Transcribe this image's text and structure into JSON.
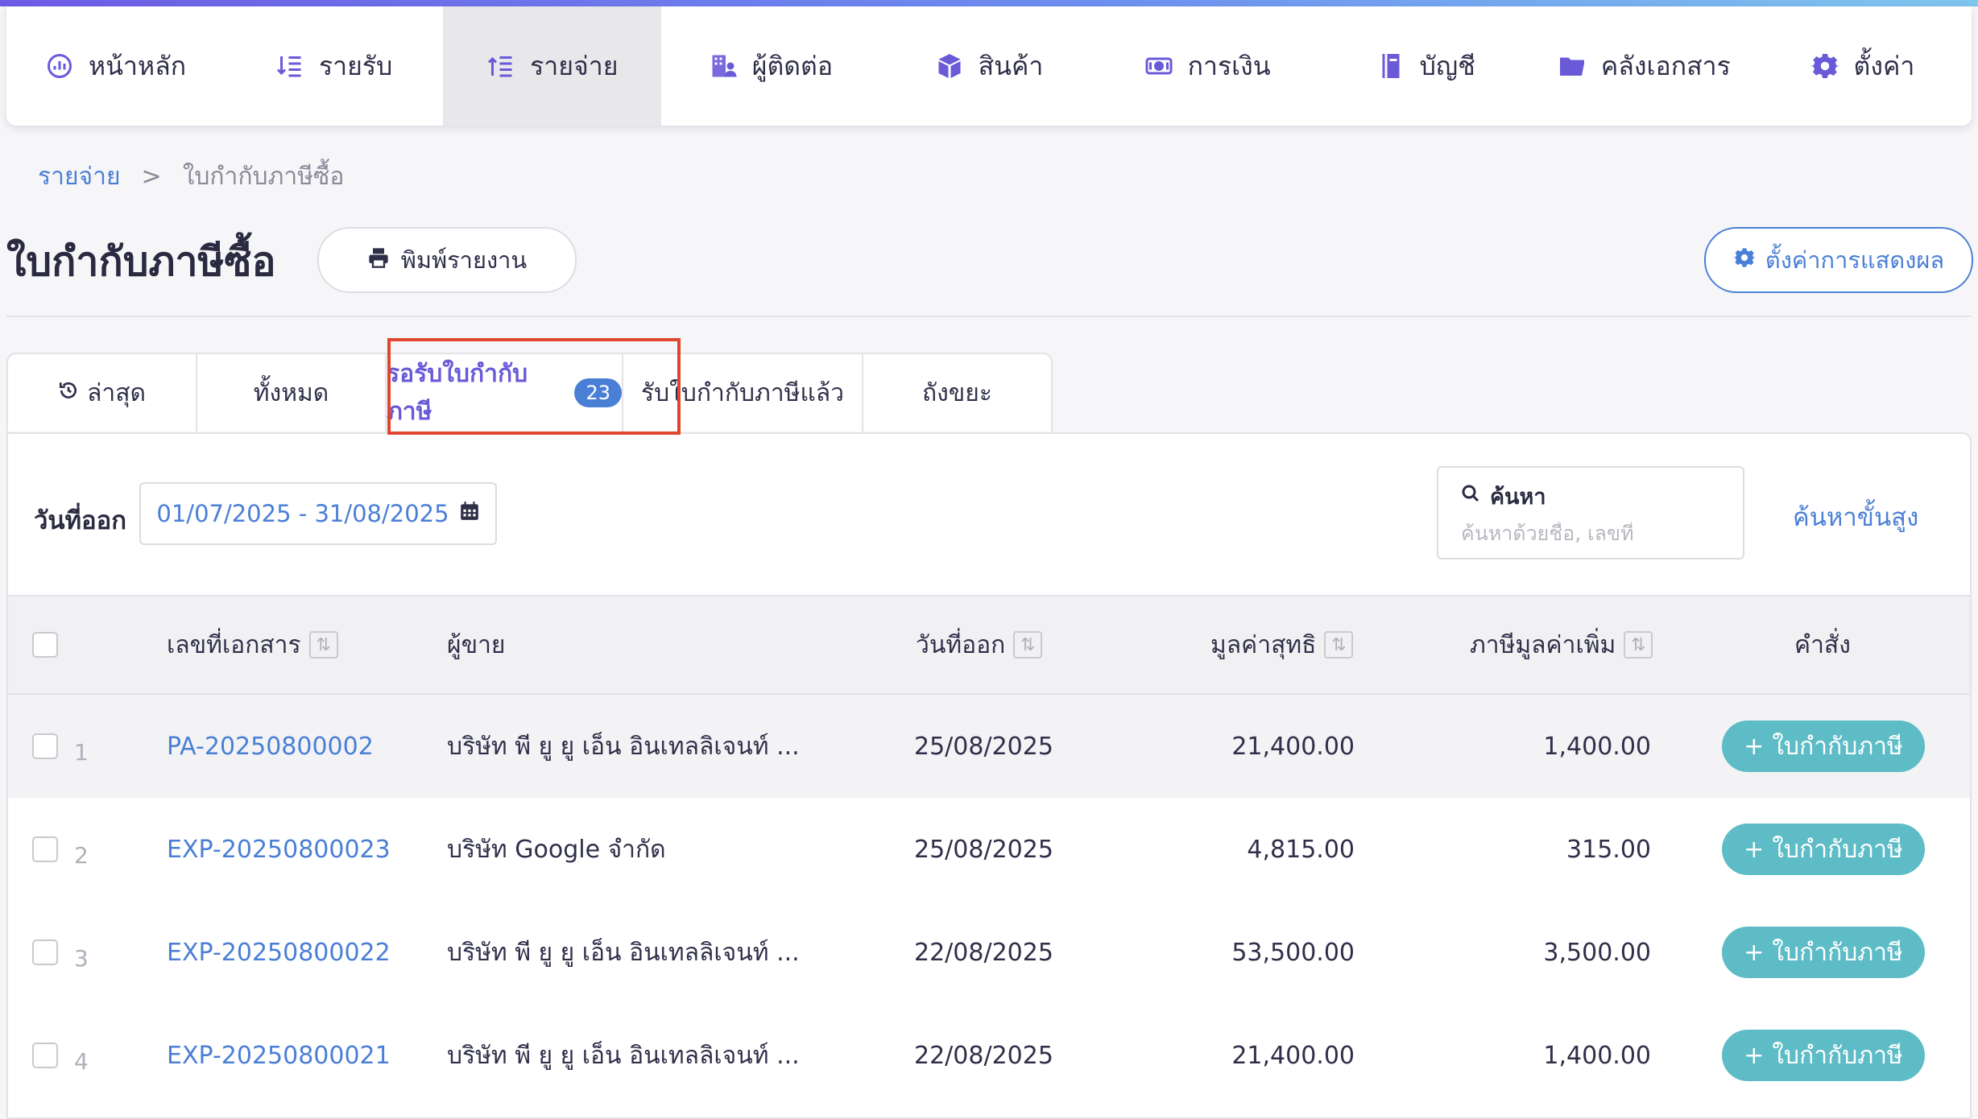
{
  "nav": {
    "items": [
      {
        "label": "หน้าหลัก",
        "icon": "dashboard-icon"
      },
      {
        "label": "รายรับ",
        "icon": "income-list-icon"
      },
      {
        "label": "รายจ่าย",
        "icon": "expense-list-icon",
        "active": true
      },
      {
        "label": "ผู้ติดต่อ",
        "icon": "contacts-building-icon"
      },
      {
        "label": "สินค้า",
        "icon": "product-box-icon"
      },
      {
        "label": "การเงิน",
        "icon": "money-icon"
      },
      {
        "label": "บัญชี",
        "icon": "ledger-book-icon"
      },
      {
        "label": "คลังเอกสาร",
        "icon": "folder-icon"
      },
      {
        "label": "ตั้งค่า",
        "icon": "gear-icon"
      }
    ]
  },
  "breadcrumb": {
    "parent": "รายจ่าย",
    "separator": ">",
    "current": "ใบกำกับภาษีซื้อ"
  },
  "page": {
    "title": "ใบกำกับภาษีซื้อ",
    "print_label": "พิมพ์รายงาน",
    "display_settings_label": "ตั้งค่าการแสดงผล"
  },
  "tabs": [
    {
      "label": "ล่าสุด",
      "icon": "history-icon"
    },
    {
      "label": "ทั้งหมด"
    },
    {
      "label": "รอรับใบกำกับภาษี",
      "badge": "23",
      "active": true
    },
    {
      "label": "รับใบกำกับภาษีแล้ว"
    },
    {
      "label": "ถังขยะ"
    }
  ],
  "filter": {
    "date_label": "วันที่ออก",
    "date_range": "01/07/2025 - 31/08/2025",
    "search_title": "ค้นหา",
    "search_placeholder": "ค้นหาด้วยชื่อ, เลขที่",
    "advanced_search": "ค้นหาขั้นสูง"
  },
  "table": {
    "columns": {
      "doc_no": "เลขที่เอกสาร",
      "vendor": "ผู้ขาย",
      "issue_date": "วันที่ออก",
      "net_value": "มูลค่าสุทธิ",
      "vat": "ภาษีมูลค่าเพิ่ม",
      "action": "คำสั่ง"
    },
    "rows": [
      {
        "num": "1",
        "doc_no": "PA-20250800002",
        "vendor": "บริษัท พี ยู ยู เอ็น อินเทลลิเจนท์ ...",
        "issue_date": "25/08/2025",
        "net_value": "21,400.00",
        "vat": "1,400.00",
        "action": "ใบกำกับภาษี"
      },
      {
        "num": "2",
        "doc_no": "EXP-20250800023",
        "vendor": "บริษัท Google จำกัด",
        "issue_date": "25/08/2025",
        "net_value": "4,815.00",
        "vat": "315.00",
        "action": "ใบกำกับภาษี"
      },
      {
        "num": "3",
        "doc_no": "EXP-20250800022",
        "vendor": "บริษัท พี ยู ยู เอ็น อินเทลลิเจนท์ ...",
        "issue_date": "22/08/2025",
        "net_value": "53,500.00",
        "vat": "3,500.00",
        "action": "ใบกำกับภาษี"
      },
      {
        "num": "4",
        "doc_no": "EXP-20250800021",
        "vendor": "บริษัท พี ยู ยู เอ็น อินเทลลิเจนท์ ...",
        "issue_date": "22/08/2025",
        "net_value": "21,400.00",
        "vat": "1,400.00",
        "action": "ใบกำกับภาษี"
      }
    ]
  },
  "colors": {
    "accent_purple": "#6a5ad8",
    "link_blue": "#4a7fd6",
    "action_teal": "#5dbcc6",
    "highlight_red": "#e0452d"
  }
}
